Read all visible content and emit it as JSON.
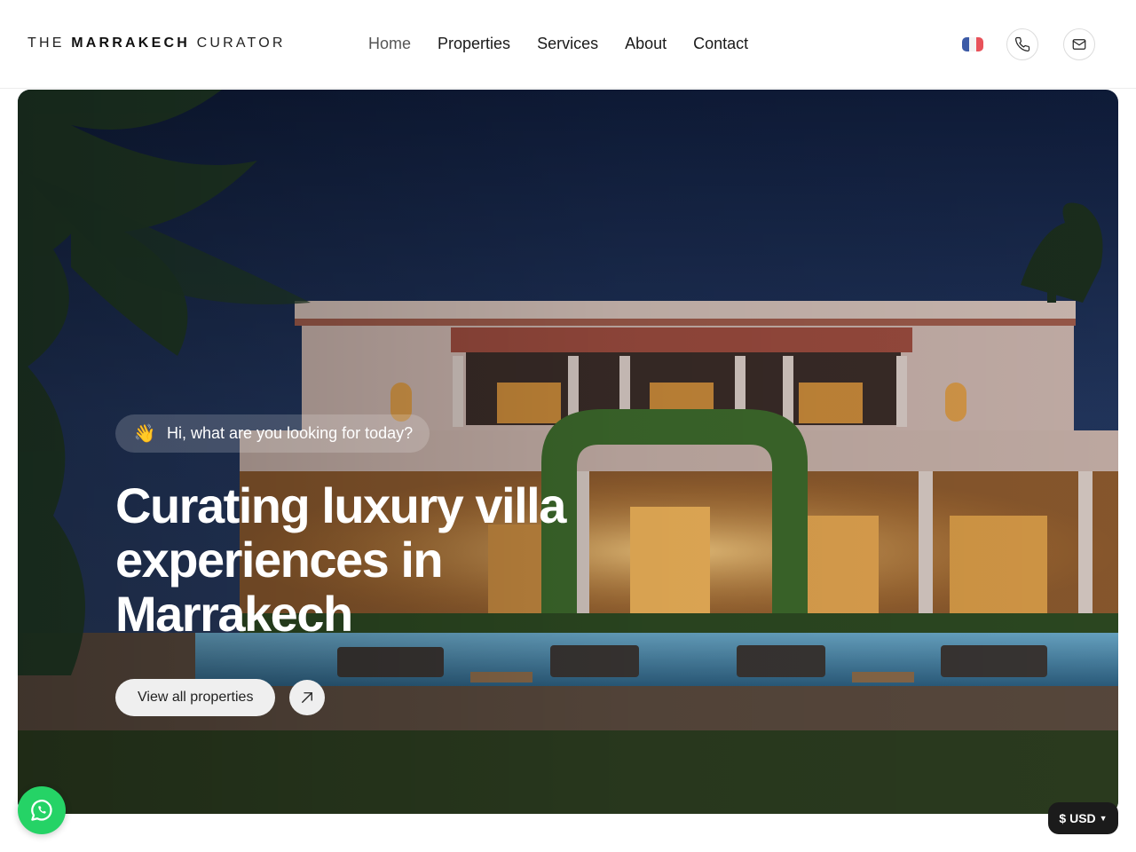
{
  "header": {
    "logo": {
      "prefix": "THE",
      "bold": "MARRAKECH",
      "suffix": "CURATOR"
    },
    "nav": [
      {
        "label": "Home",
        "active": true
      },
      {
        "label": "Properties",
        "active": false
      },
      {
        "label": "Services",
        "active": false
      },
      {
        "label": "About",
        "active": false
      },
      {
        "label": "Contact",
        "active": false
      }
    ],
    "language_icon": "france-flag-icon",
    "phone_icon": "phone-icon",
    "email_icon": "mail-icon"
  },
  "hero": {
    "greeting_icon": "waving-hand-icon",
    "greeting_text": "Hi, what are you looking for today?",
    "headline": "Curating luxury villa experiences in Marrakech",
    "cta_label": "View all properties",
    "cta_icon": "arrow-up-right-icon",
    "image_subject": "night-view-of-luxury-villa-with-pool"
  },
  "floating": {
    "whatsapp_icon": "whatsapp-icon",
    "currency_label": "$ USD"
  },
  "colors": {
    "whatsapp": "#25d366",
    "currency_bg": "#1b1b1b",
    "flag_blue": "#3c5aa6",
    "flag_red": "#e8525a"
  }
}
